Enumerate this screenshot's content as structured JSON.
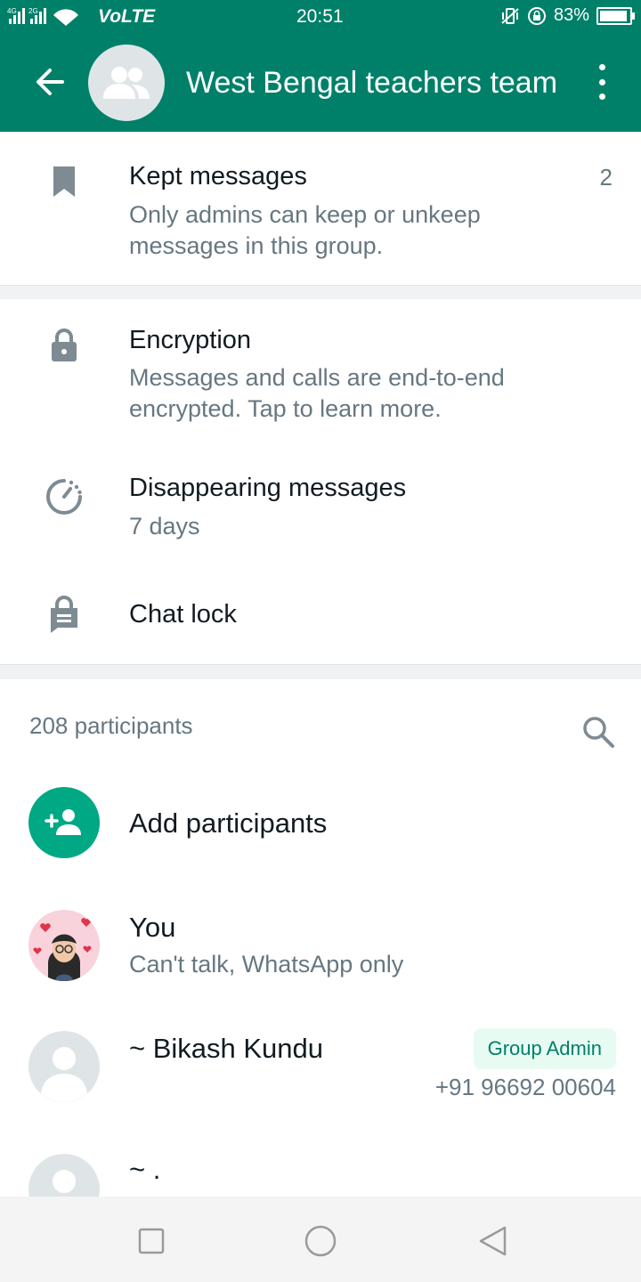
{
  "status_bar": {
    "net_left": "4G",
    "net_right": "2G",
    "volte": "VoLTE",
    "time": "20:51",
    "battery": "83%"
  },
  "header": {
    "title": "West Bengal teachers team"
  },
  "kept": {
    "title": "Kept messages",
    "subtitle": "Only admins can keep or unkeep messages in this group.",
    "count": "2"
  },
  "encryption": {
    "title": "Encryption",
    "subtitle": "Messages and calls are end-to-end encrypted. Tap to learn more."
  },
  "disappearing": {
    "title": "Disappearing messages",
    "subtitle": "7 days"
  },
  "chat_lock": {
    "title": "Chat lock"
  },
  "participants": {
    "count_label": "208 participants",
    "add_label": "Add participants",
    "list": [
      {
        "name": "You",
        "status": "Can't talk, WhatsApp only"
      },
      {
        "name": "~ Bikash Kundu",
        "badge": "Group Admin",
        "phone": "+91 96692 00604"
      },
      {
        "name": "~ ."
      }
    ]
  },
  "colors": {
    "brand": "#008069",
    "accent": "#00a884",
    "secondary_text": "#667781",
    "badge_bg": "#e7fbf3"
  },
  "icons": [
    "back-arrow-icon",
    "group-icon",
    "more-vert-icon",
    "bookmark-icon",
    "lock-icon",
    "timer-icon",
    "chat-lock-icon",
    "search-icon",
    "add-person-icon",
    "person-icon",
    "square-nav-icon",
    "circle-nav-icon",
    "triangle-nav-icon"
  ]
}
